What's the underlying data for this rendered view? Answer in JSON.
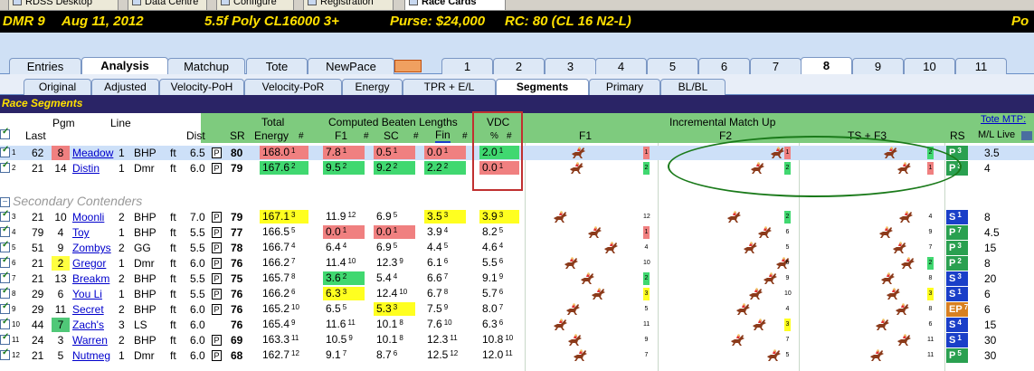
{
  "app_tabs": [
    {
      "label": "RDSS Desktop",
      "active": false
    },
    {
      "label": "Data Centre",
      "active": false
    },
    {
      "label": "Configure",
      "active": false
    },
    {
      "label": "Registration",
      "active": false
    },
    {
      "label": "Race Cards",
      "active": true
    }
  ],
  "race_header": {
    "track_race": "DMR  9",
    "date": "Aug 11, 2012",
    "conditions": "5.5f  Poly  CL16000  3+",
    "purse": "Purse: $24,000",
    "rc": "RC: 80  (CL 16 N2-L)",
    "right": "Po"
  },
  "main_tabs": [
    {
      "label": "Entries",
      "active": false
    },
    {
      "label": "Analysis",
      "active": true
    },
    {
      "label": "Matchup",
      "active": false
    },
    {
      "label": "Tote",
      "active": false
    },
    {
      "label": "NewPace",
      "active": false
    }
  ],
  "race_tabs": [
    {
      "label": "1",
      "active": false
    },
    {
      "label": "2",
      "active": false
    },
    {
      "label": "3",
      "active": false
    },
    {
      "label": "4",
      "active": false
    },
    {
      "label": "5",
      "active": false
    },
    {
      "label": "6",
      "active": false
    },
    {
      "label": "7",
      "active": false
    },
    {
      "label": "8",
      "active": true
    },
    {
      "label": "9",
      "active": false
    },
    {
      "label": "10",
      "active": false
    },
    {
      "label": "11",
      "active": false
    }
  ],
  "sub_tabs": [
    {
      "label": "Original",
      "active": false
    },
    {
      "label": "Adjusted",
      "active": false
    },
    {
      "label": "Velocity-PoH",
      "active": false
    },
    {
      "label": "Velocity-PoR",
      "active": false
    },
    {
      "label": "Energy",
      "active": false
    },
    {
      "label": "TPR + E/L",
      "active": false
    },
    {
      "label": "Segments",
      "active": true
    },
    {
      "label": "Primary",
      "active": false
    },
    {
      "label": "BL/BL",
      "active": false
    }
  ],
  "section_title": "Race Segments",
  "headers": {
    "last": "Last",
    "pgm": "Pgm",
    "line": "Line",
    "dist": "Dist",
    "sr": "SR",
    "total": "Total",
    "energy": "Energy",
    "hash": "#",
    "cbl": "Computed Beaten Lengths",
    "f1": "F1",
    "sc": "SC",
    "fin": "Fin",
    "vdc": "VDC",
    "pct": "%",
    "f1b": "F1",
    "imu": "Incremental Match Up",
    "f2": "F2",
    "tsf3": "TS + F3",
    "rs": "RS",
    "tote": "Tote MTP:",
    "ml": "M/L Live"
  },
  "secondary_label": "Secondary Contenders",
  "top_rows": [
    {
      "n": "1",
      "last": "62",
      "pgm": "8",
      "pgmc": "red",
      "name": "Meadow",
      "line": "1",
      "cls": "BHP",
      "surf": "ft",
      "dist": "6.5",
      "p": "P",
      "sr": "80",
      "energy": "168.0",
      "er": "1",
      "ec": "red",
      "f1": "7.8",
      "f1r": "1",
      "f1c": "red",
      "sc": "0.5",
      "scr": "1",
      "scc": "red",
      "fin": "0.0",
      "finr": "1",
      "finc": "red",
      "vdc": "2.0",
      "vdcr": "1",
      "vdcc": "green",
      "rs": "P",
      "rsn": "3",
      "rsc": "P",
      "ml": "3.5",
      "m1": "1",
      "m1c": "red",
      "m2": "1",
      "m2c": "red",
      "m3": "2",
      "m3c": "green",
      "sel": true
    },
    {
      "n": "2",
      "last": "21",
      "pgm": "14",
      "pgmc": "",
      "name": "Distin",
      "line": "1",
      "cls": "Dmr",
      "surf": "ft",
      "dist": "6.0",
      "p": "P",
      "sr": "79",
      "energy": "167.6",
      "er": "2",
      "ec": "green",
      "f1": "9.5",
      "f1r": "2",
      "f1c": "green",
      "sc": "9.2",
      "scr": "2",
      "scc": "green",
      "fin": "2.2",
      "finr": "2",
      "finc": "green",
      "vdc": "0.0",
      "vdcr": "1",
      "vdcc": "red",
      "rs": "P",
      "rsn": "3",
      "rsc": "P",
      "ml": "4",
      "m1": "2",
      "m1c": "green",
      "m2": "2",
      "m2c": "green",
      "m3": "1",
      "m3c": "red",
      "sel": false
    }
  ],
  "rows": [
    {
      "n": "3",
      "last": "21",
      "pgm": "10",
      "pgmc": "",
      "name": "Moonli",
      "line": "2",
      "cls": "BHP",
      "surf": "ft",
      "dist": "7.0",
      "p": "P",
      "sr": "79",
      "energy": "167.1",
      "er": "3",
      "ec": "yellow",
      "f1": "11.9",
      "f1r": "12",
      "f1c": "",
      "sc": "6.9",
      "scr": "5",
      "scc": "",
      "fin": "3.5",
      "finr": "3",
      "finc": "yellow",
      "vdc": "3.9",
      "vdcr": "3",
      "vdcc": "yellow",
      "rs": "S",
      "rsn": "1",
      "rsc": "S",
      "ml": "8",
      "m1": "12",
      "m1c": "",
      "m2": "2",
      "m2c": "green",
      "m3": "4",
      "m3c": ""
    },
    {
      "n": "4",
      "last": "79",
      "pgm": "4",
      "pgmc": "",
      "name": "Toy",
      "line": "1",
      "cls": "BHP",
      "surf": "ft",
      "dist": "5.5",
      "p": "P",
      "sr": "77",
      "energy": "166.5",
      "er": "5",
      "ec": "",
      "f1": "0.0",
      "f1r": "1",
      "f1c": "red",
      "sc": "0.0",
      "scr": "1",
      "scc": "red",
      "fin": "3.9",
      "finr": "4",
      "finc": "",
      "vdc": "8.2",
      "vdcr": "5",
      "vdcc": "",
      "rs": "P",
      "rsn": "7",
      "rsc": "P",
      "ml": "4.5",
      "m1": "1",
      "m1c": "red",
      "m2": "6",
      "m2c": "",
      "m3": "9",
      "m3c": ""
    },
    {
      "n": "5",
      "last": "51",
      "pgm": "9",
      "pgmc": "",
      "name": "Zombys",
      "line": "2",
      "cls": "GG",
      "surf": "ft",
      "dist": "5.5",
      "p": "P",
      "sr": "78",
      "energy": "166.7",
      "er": "4",
      "ec": "",
      "f1": "6.4",
      "f1r": "4",
      "f1c": "",
      "sc": "6.9",
      "scr": "5",
      "scc": "",
      "fin": "4.4",
      "finr": "5",
      "finc": "",
      "vdc": "4.6",
      "vdcr": "4",
      "vdcc": "",
      "rs": "P",
      "rsn": "3",
      "rsc": "P",
      "ml": "15",
      "m1": "4",
      "m1c": "",
      "m2": "5",
      "m2c": "",
      "m3": "7",
      "m3c": ""
    },
    {
      "n": "6",
      "last": "21",
      "pgm": "2",
      "pgmc": "yellow",
      "name": "Gregor",
      "line": "1",
      "cls": "Dmr",
      "surf": "ft",
      "dist": "6.0",
      "p": "P",
      "sr": "76",
      "energy": "166.2",
      "er": "7",
      "ec": "",
      "f1": "11.4",
      "f1r": "10",
      "f1c": "",
      "sc": "12.3",
      "scr": "9",
      "scc": "",
      "fin": "6.1",
      "finr": "6",
      "finc": "",
      "vdc": "5.5",
      "vdcr": "6",
      "vdcc": "",
      "rs": "P",
      "rsn": "2",
      "rsc": "P",
      "ml": "8",
      "m1": "10",
      "m1c": "",
      "m2": "6",
      "m2c": "",
      "m3": "2",
      "m3c": "green"
    },
    {
      "n": "7",
      "last": "21",
      "pgm": "13",
      "pgmc": "",
      "name": "Breakm",
      "line": "2",
      "cls": "BHP",
      "surf": "ft",
      "dist": "5.5",
      "p": "P",
      "sr": "75",
      "energy": "165.7",
      "er": "8",
      "ec": "",
      "f1": "3.6",
      "f1r": "2",
      "f1c": "green",
      "sc": "5.4",
      "scr": "4",
      "scc": "",
      "fin": "6.6",
      "finr": "7",
      "finc": "",
      "vdc": "9.1",
      "vdcr": "9",
      "vdcc": "",
      "rs": "S",
      "rsn": "3",
      "rsc": "S",
      "ml": "20",
      "m1": "2",
      "m1c": "green",
      "m2": "9",
      "m2c": "",
      "m3": "8",
      "m3c": ""
    },
    {
      "n": "8",
      "last": "29",
      "pgm": "6",
      "pgmc": "",
      "name": "You Li",
      "line": "1",
      "cls": "BHP",
      "surf": "ft",
      "dist": "5.5",
      "p": "P",
      "sr": "76",
      "energy": "166.2",
      "er": "6",
      "ec": "",
      "f1": "6.3",
      "f1r": "3",
      "f1c": "yellow",
      "sc": "12.4",
      "scr": "10",
      "scc": "",
      "fin": "6.7",
      "finr": "8",
      "finc": "",
      "vdc": "5.7",
      "vdcr": "6",
      "vdcc": "",
      "rs": "S",
      "rsn": "1",
      "rsc": "S",
      "ml": "6",
      "m1": "3",
      "m1c": "yellow",
      "m2": "10",
      "m2c": "",
      "m3": "3",
      "m3c": "yellow"
    },
    {
      "n": "9",
      "last": "29",
      "pgm": "11",
      "pgmc": "",
      "name": "Secret",
      "line": "2",
      "cls": "BHP",
      "surf": "ft",
      "dist": "6.0",
      "p": "P",
      "sr": "76",
      "energy": "165.2",
      "er": "10",
      "ec": "",
      "f1": "6.5",
      "f1r": "5",
      "f1c": "",
      "sc": "5.3",
      "scr": "3",
      "scc": "yellow",
      "fin": "7.5",
      "finr": "9",
      "finc": "",
      "vdc": "8.0",
      "vdcr": "7",
      "vdcc": "",
      "rs": "EP",
      "rsn": "7",
      "rsc": "EP",
      "ml": "6",
      "m1": "5",
      "m1c": "",
      "m2": "4",
      "m2c": "",
      "m3": "8",
      "m3c": ""
    },
    {
      "n": "10",
      "last": "44",
      "pgm": "7",
      "pgmc": "green",
      "name": "Zach's",
      "line": "3",
      "cls": "LS",
      "surf": "ft",
      "dist": "6.0",
      "p": "",
      "sr": "76",
      "energy": "165.4",
      "er": "9",
      "ec": "",
      "f1": "11.6",
      "f1r": "11",
      "f1c": "",
      "sc": "10.1",
      "scr": "8",
      "scc": "",
      "fin": "7.6",
      "finr": "10",
      "finc": "",
      "vdc": "6.3",
      "vdcr": "6",
      "vdcc": "",
      "rs": "S",
      "rsn": "4",
      "rsc": "S",
      "ml": "15",
      "m1": "11",
      "m1c": "",
      "m2": "3",
      "m2c": "yellow",
      "m3": "6",
      "m3c": ""
    },
    {
      "n": "11",
      "last": "24",
      "pgm": "3",
      "pgmc": "",
      "name": "Warren",
      "line": "2",
      "cls": "BHP",
      "surf": "ft",
      "dist": "6.0",
      "p": "P",
      "sr": "69",
      "energy": "163.3",
      "er": "11",
      "ec": "",
      "f1": "10.5",
      "f1r": "9",
      "f1c": "",
      "sc": "10.1",
      "scr": "8",
      "scc": "",
      "fin": "12.3",
      "finr": "11",
      "finc": "",
      "vdc": "10.8",
      "vdcr": "10",
      "vdcc": "",
      "rs": "S",
      "rsn": "1",
      "rsc": "S",
      "ml": "30",
      "m1": "9",
      "m1c": "",
      "m2": "7",
      "m2c": "",
      "m3": "11",
      "m3c": ""
    },
    {
      "n": "12",
      "last": "21",
      "pgm": "5",
      "pgmc": "",
      "name": "Nutmeg",
      "line": "1",
      "cls": "Dmr",
      "surf": "ft",
      "dist": "6.0",
      "p": "P",
      "sr": "68",
      "energy": "162.7",
      "er": "12",
      "ec": "",
      "f1": "9.1",
      "f1r": "7",
      "f1c": "",
      "sc": "8.7",
      "scr": "6",
      "scc": "",
      "fin": "12.5",
      "finr": "12",
      "finc": "",
      "vdc": "12.0",
      "vdcr": "11",
      "vdcc": "",
      "rs": "P",
      "rsn": "5",
      "rsc": "P",
      "ml": "30",
      "m1": "7",
      "m1c": "",
      "m2": "5",
      "m2c": "",
      "m3": "11",
      "m3c": ""
    }
  ],
  "colors": {
    "header_bg": "#000000",
    "header_text": "#ffe000",
    "band": "#7ecb7e",
    "section": "#2a2466",
    "red": "#f08080",
    "green": "#40d870",
    "yellow": "#ffff20"
  },
  "icons": [
    "race-horse-icon",
    "checkbox-icon",
    "expander-minus-icon",
    "newpace-flag-icon"
  ]
}
